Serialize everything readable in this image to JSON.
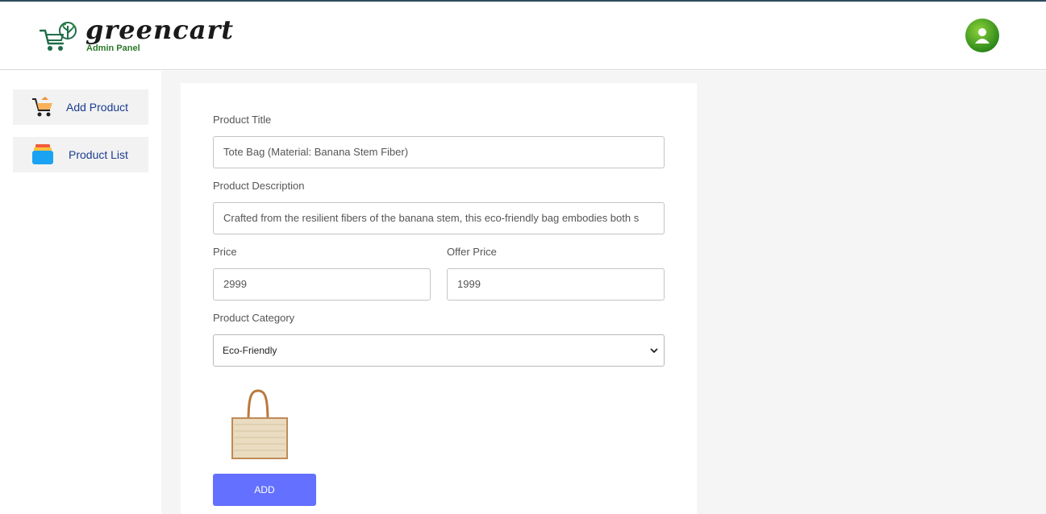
{
  "header": {
    "brand": "greencart",
    "subtitle": "Admin Panel",
    "avatar_icon": "user-icon",
    "accent": "#2f8a1a"
  },
  "sidebar": {
    "items": [
      {
        "label": "Add Product",
        "icon": "cart-icon"
      },
      {
        "label": "Product List",
        "icon": "stack-icon"
      }
    ],
    "label_color": "#1a3d8f"
  },
  "form": {
    "title_label": "Product Title",
    "title_value": "Tote Bag (Material: Banana Stem Fiber)",
    "description_label": "Product Description",
    "description_value": "Crafted from the resilient fibers of the banana stem, this eco-friendly bag embodies both s",
    "price_label": "Price",
    "price_value": "2999",
    "offer_label": "Offer Price",
    "offer_value": "1999",
    "category_label": "Product Category",
    "category_value": "Eco-Friendly",
    "image_icon": "tote-bag-image",
    "submit_label": "ADD",
    "submit_color": "#6470ff"
  }
}
